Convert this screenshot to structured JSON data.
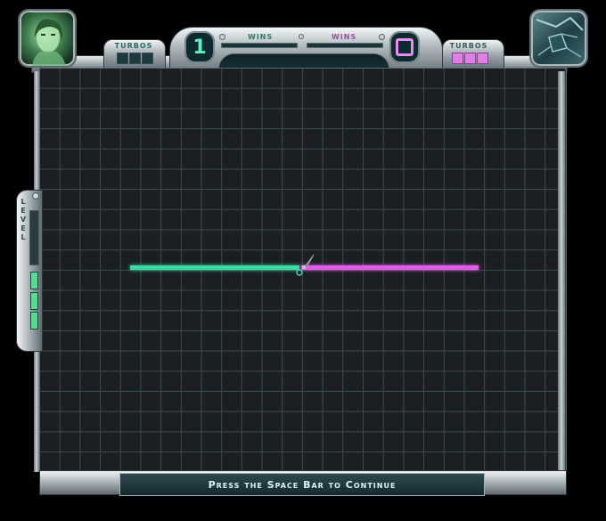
{
  "hud": {
    "player1": {
      "turbos_label": "TURBOS",
      "turbos_total": 3,
      "turbos_filled": 0,
      "score": "1",
      "wins_label": "WINS",
      "color": "#3fd6a4"
    },
    "player2": {
      "turbos_label": "TURBOS",
      "turbos_total": 3,
      "turbos_filled": 3,
      "score": "0",
      "wins_label": "WINS",
      "color": "#e86be6"
    }
  },
  "level": {
    "letters": [
      "L",
      "E",
      "V",
      "E",
      "L"
    ],
    "segments_total": 3,
    "segments_filled": 3
  },
  "message": "Press the Space Bar to Continue",
  "colors": {
    "p1_trail": "#3ed9a1",
    "p2_trail": "#e05ee6",
    "grid": "#3b4b52"
  }
}
